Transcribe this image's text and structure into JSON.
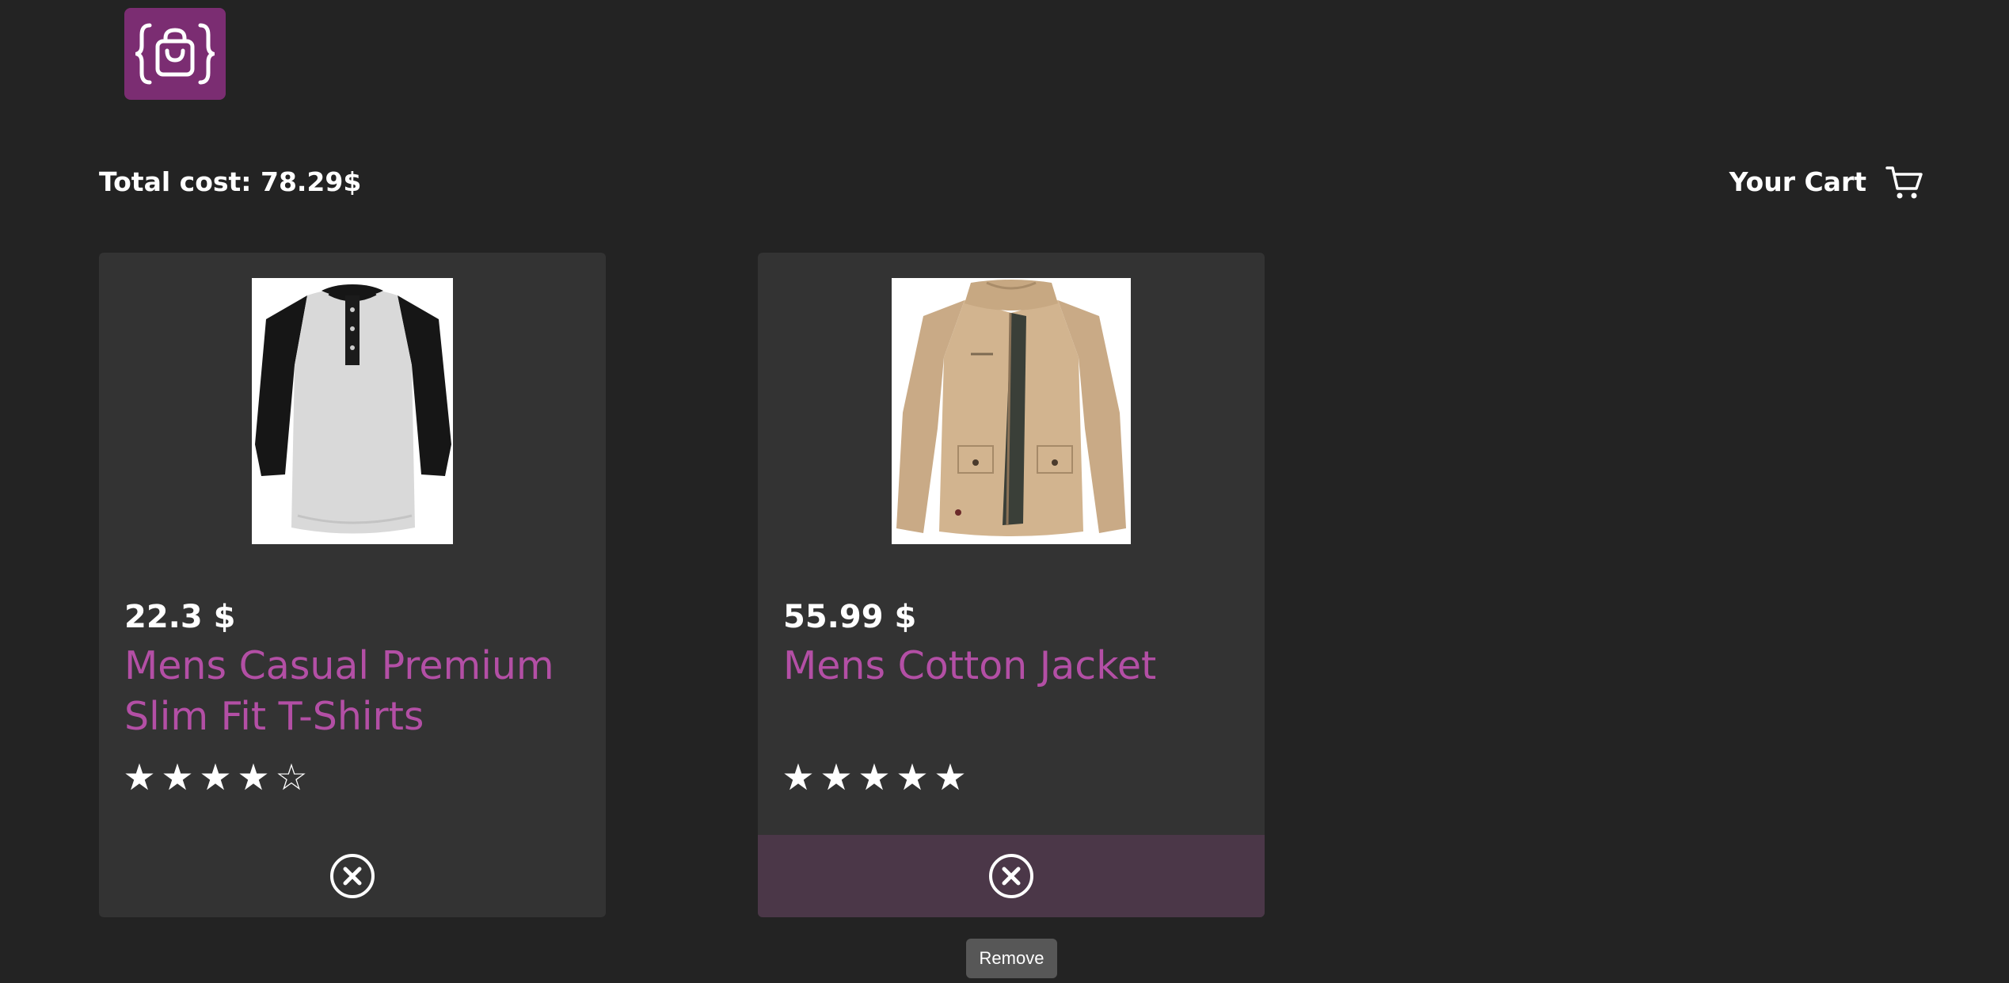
{
  "brand": {
    "logo_icon": "shopping-bag-braces-icon",
    "color": "#7b2d72"
  },
  "header": {
    "total_cost": "Total cost: 78.29$",
    "cart_label": "Your Cart",
    "cart_icon": "cart-icon"
  },
  "cart_items": [
    {
      "price": "22.3 $",
      "title": "Mens Casual Premium Slim Fit T-Shirts",
      "rating": 4,
      "rating_max": 5,
      "remove_icon": "close-circle-icon"
    },
    {
      "price": "55.99 $",
      "title": "Mens Cotton Jacket",
      "rating": 5,
      "rating_max": 5,
      "remove_icon": "close-circle-icon"
    }
  ],
  "tooltip": {
    "text": "Remove"
  },
  "colors": {
    "background": "#232323",
    "card": "#333333",
    "title": "#b34fa5",
    "hover": "#4b3748"
  }
}
